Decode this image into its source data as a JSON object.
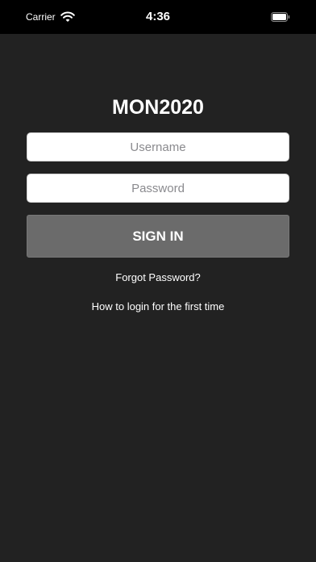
{
  "status_bar": {
    "carrier": "Carrier",
    "time": "4:36",
    "wifi_icon": "wifi-icon",
    "battery_icon": "battery-icon",
    "background_color": "#000000"
  },
  "login": {
    "title": "MON2020",
    "username": {
      "value": "",
      "placeholder": "Username"
    },
    "password": {
      "value": "",
      "placeholder": "Password"
    },
    "sign_in_label": "SIGN IN",
    "forgot_password_label": "Forgot Password?",
    "first_time_label": "How to login for the first time"
  },
  "colors": {
    "background": "#222222",
    "button": "#6b6b6b",
    "text": "#ffffff",
    "field_background": "#ffffff"
  }
}
